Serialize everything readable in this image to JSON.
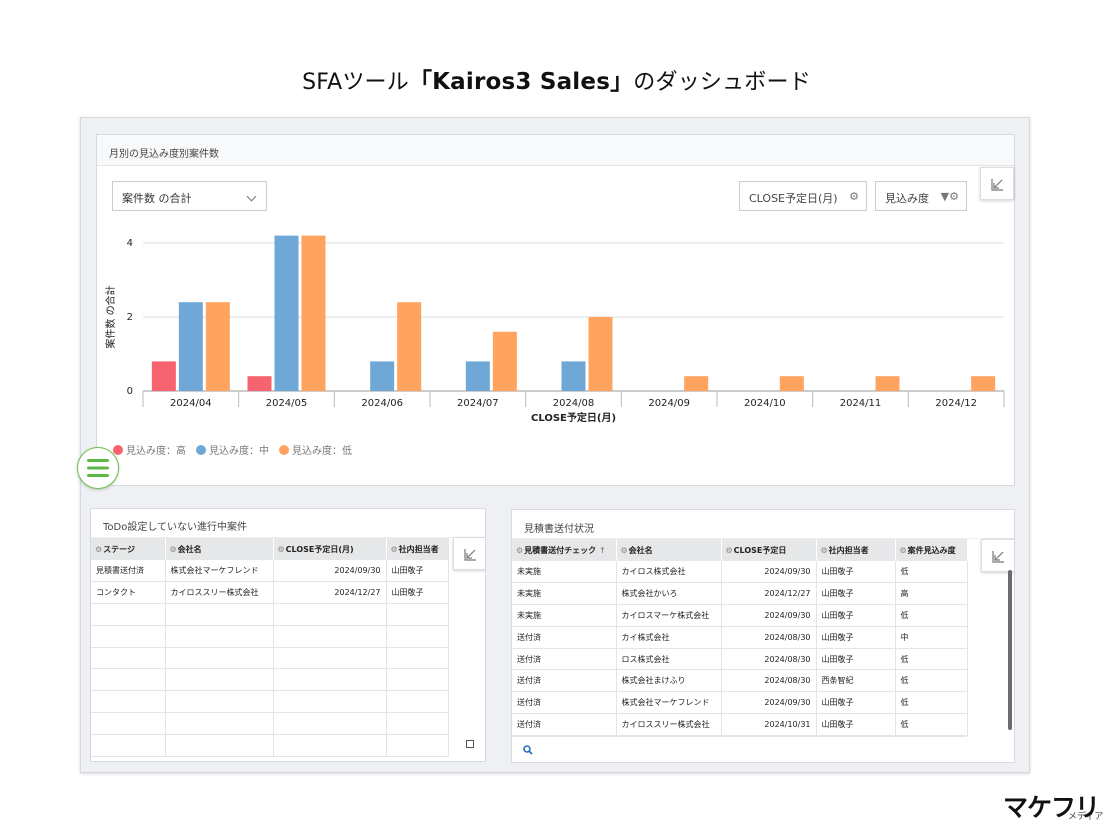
{
  "title": {
    "prefix": "SFAツール",
    "brand": "「Kairos3 Sales」",
    "suffix": "のダッシュボード"
  },
  "chart_panel": {
    "title": "月別の見込み度別案件数",
    "aggregate_dropdown": "案件数 の合計",
    "x_field_button": "CLOSE予定日(月)",
    "group_field_button": "見込み度"
  },
  "chart_data": {
    "type": "bar",
    "categories": [
      "2024/04",
      "2024/05",
      "2024/06",
      "2024/07",
      "2024/08",
      "2024/09",
      "2024/10",
      "2024/11",
      "2024/12"
    ],
    "series": [
      {
        "name": "見込み度：高",
        "color": "#f7636f",
        "values": [
          0.8,
          0.4,
          0,
          0,
          0,
          0,
          0,
          0,
          0
        ]
      },
      {
        "name": "見込み度：中",
        "color": "#6fa8d6",
        "values": [
          2.4,
          4.2,
          0.8,
          0.8,
          0.8,
          0,
          0,
          0,
          0
        ]
      },
      {
        "name": "見込み度：低",
        "color": "#ffa35e",
        "values": [
          2.4,
          4.2,
          2.4,
          1.6,
          2.0,
          0.4,
          0.4,
          0.4,
          0.4
        ]
      }
    ],
    "xlabel": "CLOSE予定日(月)",
    "ylabel": "案件数 の合計",
    "yticks": [
      "0",
      "2",
      "4"
    ],
    "ylim": [
      0,
      4.3
    ],
    "grid": true,
    "legend": "bottom-left"
  },
  "todo_table": {
    "title": "ToDo設定していない進行中案件",
    "columns": [
      "ステージ",
      "会社名",
      "CLOSE予定日(月)",
      "社内担当者"
    ],
    "rows": [
      [
        "見積書送付済",
        "株式会社マーケフレンド",
        "2024/09/30",
        "山田敬子"
      ],
      [
        "コンタクト",
        "カイロススリー株式会社",
        "2024/12/27",
        "山田敬子"
      ]
    ]
  },
  "quote_table": {
    "title": "見積書送付状況",
    "columns": [
      "見積書送付チェック",
      "会社名",
      "CLOSE予定日",
      "社内担当者",
      "案件見込み度"
    ],
    "sort_indicator": "↑",
    "rows": [
      [
        "未実施",
        "カイロス株式会社",
        "2024/09/30",
        "山田敬子",
        "低"
      ],
      [
        "未実施",
        "株式会社かいろ",
        "2024/12/27",
        "山田敬子",
        "高"
      ],
      [
        "未実施",
        "カイロスマーケ株式会社",
        "2024/09/30",
        "山田敬子",
        "低"
      ],
      [
        "送付済",
        "カイ株式会社",
        "2024/08/30",
        "山田敬子",
        "中"
      ],
      [
        "送付済",
        "ロス株式会社",
        "2024/08/30",
        "山田敬子",
        "低"
      ],
      [
        "送付済",
        "株式会社まけふり",
        "2024/08/30",
        "西条智紀",
        "低"
      ],
      [
        "送付済",
        "株式会社マーケフレンド",
        "2024/09/30",
        "山田敬子",
        "低"
      ],
      [
        "送付済",
        "カイロススリー株式会社",
        "2024/10/31",
        "山田敬子",
        "低"
      ]
    ]
  },
  "logo": {
    "main": "マケフリ",
    "sub": "メディア"
  }
}
